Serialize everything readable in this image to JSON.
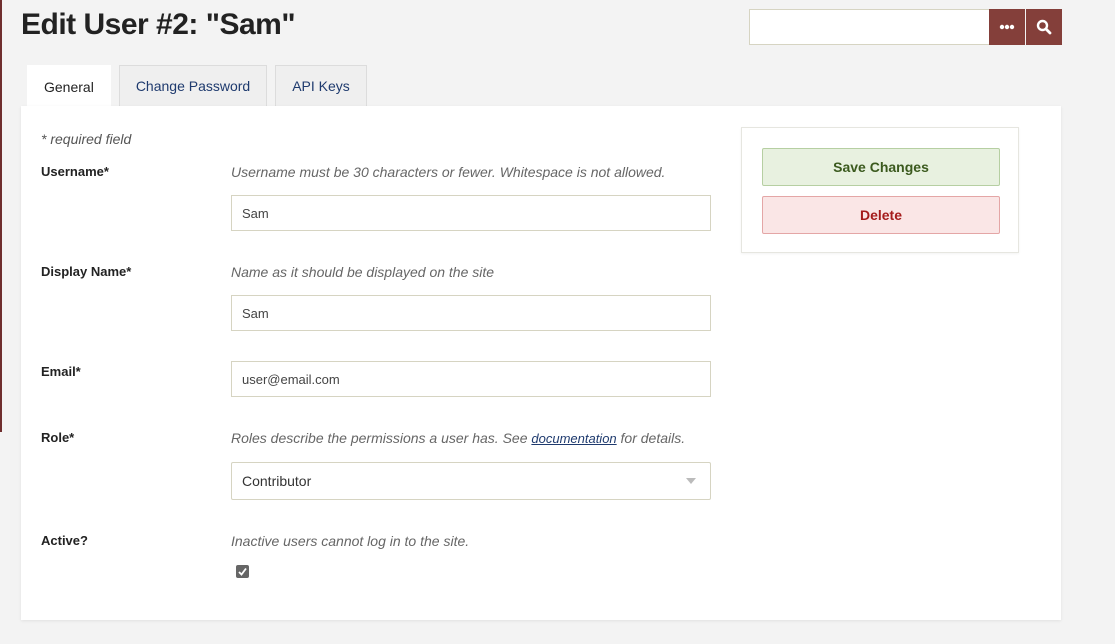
{
  "page": {
    "title": "Edit User #2: \"Sam\""
  },
  "search": {
    "value": "",
    "placeholder": "",
    "more_icon": "ellipsis-icon",
    "search_icon": "search-icon"
  },
  "tabs": [
    {
      "label": "General",
      "active": true
    },
    {
      "label": "Change Password",
      "active": false
    },
    {
      "label": "API Keys",
      "active": false
    }
  ],
  "form": {
    "required_note": "* required field",
    "username": {
      "label": "Username*",
      "help": "Username must be 30 characters or fewer. Whitespace is not allowed.",
      "value": "Sam"
    },
    "display_name": {
      "label": "Display Name*",
      "help": "Name as it should be displayed on the site",
      "value": "Sam"
    },
    "email": {
      "label": "Email*",
      "value": "user@email.com"
    },
    "role": {
      "label": "Role*",
      "help_before": "Roles describe the permissions a user has. See ",
      "help_link": "documentation",
      "help_after": " for details.",
      "value": "Contributor"
    },
    "active": {
      "label": "Active?",
      "help": "Inactive users cannot log in to the site.",
      "checked": true
    }
  },
  "actions": {
    "save_label": "Save Changes",
    "delete_label": "Delete"
  },
  "colors": {
    "brand": "#843f3a",
    "save_bg": "#e8f1e0",
    "delete_bg": "#fae6e6"
  }
}
